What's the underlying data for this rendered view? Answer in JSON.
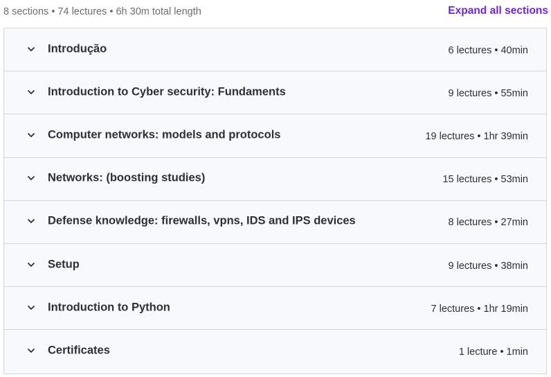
{
  "summary": {
    "text": "8 sections • 74 lectures • 6h 30m total length",
    "expand_label": "Expand all sections"
  },
  "colors": {
    "accent": "#6d28d2",
    "row_background": "#f7f9fa",
    "border": "#d1d7dc",
    "text": "#2d2f31",
    "muted_text": "#6a6f73"
  },
  "sections": [
    {
      "title": "Introdução",
      "meta": "6 lectures • 40min",
      "icon": "chevron-down-icon"
    },
    {
      "title": "Introduction to Cyber security: Fundaments",
      "meta": "9 lectures • 55min",
      "icon": "chevron-down-icon"
    },
    {
      "title": "Computer networks: models and protocols",
      "meta": "19 lectures • 1hr 39min",
      "icon": "chevron-down-icon"
    },
    {
      "title": "Networks: (boosting studies)",
      "meta": "15 lectures • 53min",
      "icon": "chevron-down-icon"
    },
    {
      "title": "Defense knowledge: firewalls, vpns, IDS and IPS devices",
      "meta": "8 lectures • 27min",
      "icon": "chevron-down-icon"
    },
    {
      "title": "Setup",
      "meta": "9 lectures • 38min",
      "icon": "chevron-down-icon"
    },
    {
      "title": "Introduction to Python",
      "meta": "7 lectures • 1hr 19min",
      "icon": "chevron-down-icon"
    },
    {
      "title": "Certificates",
      "meta": "1 lecture • 1min",
      "icon": "chevron-down-icon"
    }
  ]
}
